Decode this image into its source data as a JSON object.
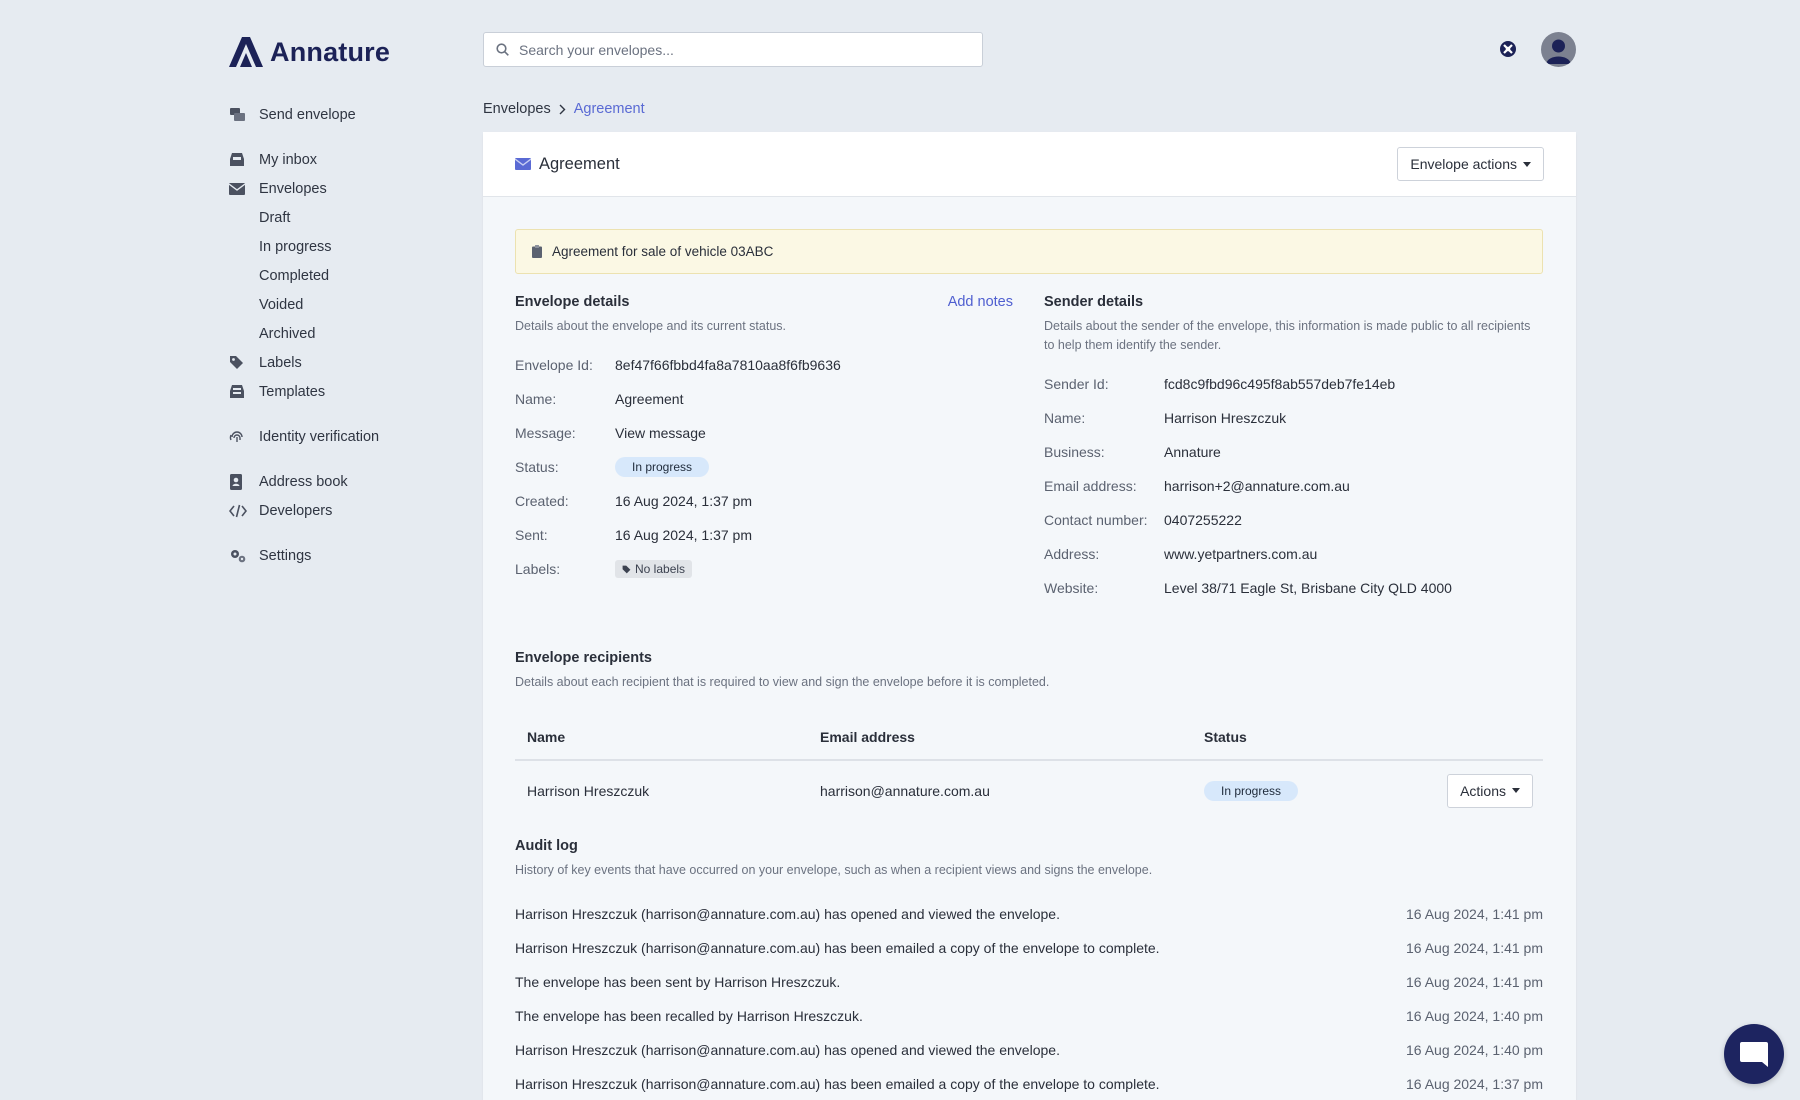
{
  "brand": {
    "name": "Annature",
    "color": "#1c2257",
    "accent": "#4f5fd0"
  },
  "search": {
    "placeholder": "Search your envelopes..."
  },
  "sidebar": {
    "primary": [
      {
        "label": "Send envelope",
        "icon": "send-envelope-icon"
      }
    ],
    "mail": [
      {
        "label": "My inbox",
        "icon": "inbox-icon"
      },
      {
        "label": "Envelopes",
        "icon": "envelope-icon"
      }
    ],
    "envelope_subitems": [
      "Draft",
      "In progress",
      "Completed",
      "Voided",
      "Archived"
    ],
    "more": [
      {
        "label": "Labels",
        "icon": "tag-icon"
      },
      {
        "label": "Templates",
        "icon": "templates-icon"
      }
    ],
    "identity": {
      "label": "Identity verification",
      "icon": "fingerprint-icon"
    },
    "tools": [
      {
        "label": "Address book",
        "icon": "address-book-icon"
      },
      {
        "label": "Developers",
        "icon": "code-icon"
      }
    ],
    "settings": {
      "label": "Settings",
      "icon": "gears-icon"
    }
  },
  "breadcrumb": {
    "root": "Envelopes",
    "current": "Agreement"
  },
  "envelope": {
    "title": "Agreement",
    "actions_label": "Envelope actions",
    "notice": "Agreement for sale of vehicle 03ABC"
  },
  "envelope_details": {
    "title": "Envelope details",
    "add_notes": "Add notes",
    "description": "Details about the envelope and its current status.",
    "fields": {
      "id_label": "Envelope Id:",
      "id_value": "8ef47f66fbbd4fa8a7810aa8f6fb9636",
      "name_label": "Name:",
      "name_value": "Agreement",
      "message_label": "Message:",
      "message_value": "View message",
      "status_label": "Status:",
      "status_value": "In progress",
      "created_label": "Created:",
      "created_value": "16 Aug 2024, 1:37 pm",
      "sent_label": "Sent:",
      "sent_value": "16 Aug 2024, 1:37 pm",
      "labels_label": "Labels:",
      "labels_value": "No labels"
    }
  },
  "sender_details": {
    "title": "Sender details",
    "description": "Details about the sender of the envelope, this information is made public to all recipients to help them identify the sender.",
    "rows": [
      {
        "k": "Sender Id:",
        "v": "fcd8c9fbd96c495f8ab557deb7fe14eb"
      },
      {
        "k": "Name:",
        "v": "Harrison Hreszczuk"
      },
      {
        "k": "Business:",
        "v": "Annature"
      },
      {
        "k": "Email address:",
        "v": "harrison+2@annature.com.au"
      },
      {
        "k": "Contact number:",
        "v": "0407255222"
      },
      {
        "k": "Address:",
        "v": "www.yetpartners.com.au"
      },
      {
        "k": "Website:",
        "v": "Level 38/71 Eagle St, Brisbane City QLD 4000"
      }
    ]
  },
  "recipients": {
    "title": "Envelope recipients",
    "description": "Details about each recipient that is required to view and sign the envelope before it is completed.",
    "columns": [
      "Name",
      "Email address",
      "Status"
    ],
    "rows": [
      {
        "name": "Harrison Hreszczuk",
        "email": "harrison@annature.com.au",
        "status": "In progress",
        "action": "Actions"
      }
    ]
  },
  "audit": {
    "title": "Audit log",
    "description": "History of key events that have occurred on your envelope, such as when a recipient views and signs the envelope.",
    "events": [
      {
        "text": "Harrison Hreszczuk (harrison@annature.com.au) has opened and viewed the envelope.",
        "when": "16 Aug 2024, 1:41 pm"
      },
      {
        "text": "Harrison Hreszczuk (harrison@annature.com.au) has been emailed a copy of the envelope to complete.",
        "when": "16 Aug 2024, 1:41 pm"
      },
      {
        "text": "The envelope has been sent by Harrison Hreszczuk.",
        "when": "16 Aug 2024, 1:41 pm"
      },
      {
        "text": "The envelope has been recalled by Harrison Hreszczuk.",
        "when": "16 Aug 2024, 1:40 pm"
      },
      {
        "text": "Harrison Hreszczuk (harrison@annature.com.au) has opened and viewed the envelope.",
        "when": "16 Aug 2024, 1:40 pm"
      },
      {
        "text": "Harrison Hreszczuk (harrison@annature.com.au) has been emailed a copy of the envelope to complete.",
        "when": "16 Aug 2024, 1:37 pm"
      }
    ]
  }
}
